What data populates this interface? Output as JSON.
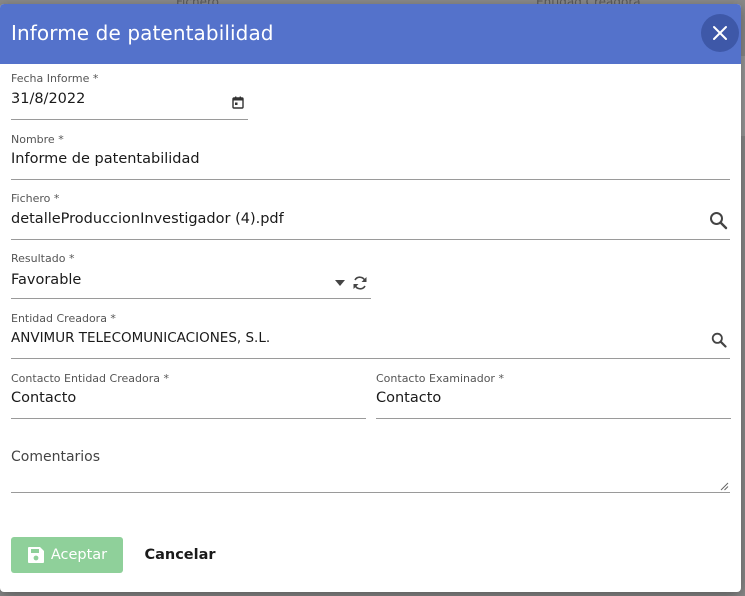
{
  "dialog": {
    "title": "Informe de patentabilidad",
    "header_color": "#5472cb"
  },
  "background": {
    "col_fichero": "Fichero",
    "col_entidad": "Entidad Creadora"
  },
  "form": {
    "fecha": {
      "label": "Fecha Informe *",
      "value": "31/8/2022"
    },
    "nombre": {
      "label": "Nombre *",
      "value": "Informe de patentabilidad"
    },
    "fichero": {
      "label": "Fichero *",
      "value": "detalleProduccionInvestigador (4).pdf"
    },
    "resultado": {
      "label": "Resultado *",
      "value": "Favorable"
    },
    "entidad": {
      "label": "Entidad Creadora *",
      "value": "ANVIMUR TELECOMUNICACIONES, S.L."
    },
    "contacto_entidad": {
      "label": "Contacto Entidad Creadora *",
      "value": "Contacto"
    },
    "contacto_examinador": {
      "label": "Contacto Examinador *",
      "value": "Contacto"
    },
    "comentarios": {
      "label": "Comentarios",
      "value": ""
    }
  },
  "actions": {
    "accept_label": "Aceptar",
    "accept_color": "#8fd09a",
    "cancel_label": "Cancelar"
  }
}
